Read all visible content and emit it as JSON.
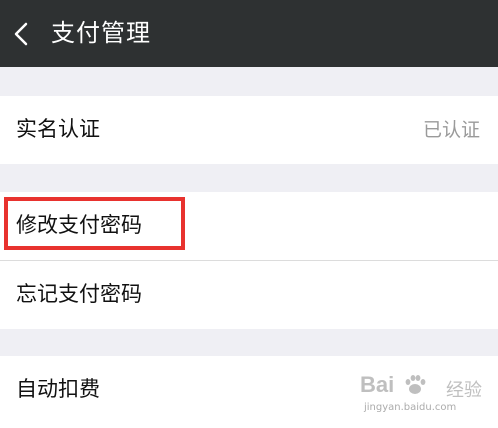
{
  "header": {
    "title": "支付管理",
    "back_icon": "chevron-left-icon"
  },
  "groups": [
    {
      "items": [
        {
          "label": "实名认证",
          "value": "已认证"
        }
      ]
    },
    {
      "items": [
        {
          "label": "修改支付密码"
        },
        {
          "label": "忘记支付密码"
        }
      ]
    },
    {
      "items": [
        {
          "label": "自动扣费"
        }
      ]
    }
  ],
  "watermark": {
    "logo_text": "Bai",
    "logo_suffix": "经验",
    "url": "jingyan.baidu.com"
  },
  "colors": {
    "header_bg": "#2e3132",
    "page_bg": "#efeff4",
    "highlight": "#e8322e"
  }
}
